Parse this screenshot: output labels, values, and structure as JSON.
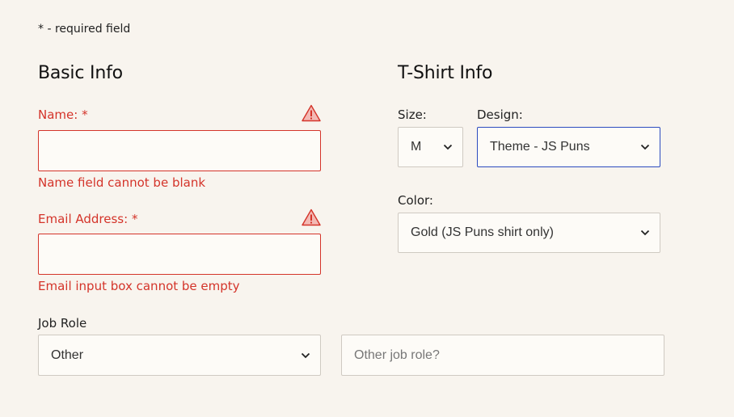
{
  "required_note": {
    "star": "*",
    "text": " - required field"
  },
  "basic_info": {
    "heading": "Basic Info",
    "name": {
      "label": "Name:",
      "star": "*",
      "value": "",
      "error": "Name field cannot be blank"
    },
    "email": {
      "label": "Email Address:",
      "star": "*",
      "value": "",
      "error": "Email input box cannot be empty"
    }
  },
  "tshirt_info": {
    "heading": "T-Shirt Info",
    "size": {
      "label": "Size:",
      "selected": "M"
    },
    "design": {
      "label": "Design:",
      "selected": "Theme - JS Puns"
    },
    "color": {
      "label": "Color:",
      "selected": "Gold (JS Puns shirt only)"
    }
  },
  "job_role": {
    "label": "Job Role",
    "selected": "Other",
    "other_placeholder": "Other job role?"
  },
  "colors": {
    "error": "#d4342a",
    "focus": "#2c4bbf",
    "background": "#f8f4ee"
  }
}
